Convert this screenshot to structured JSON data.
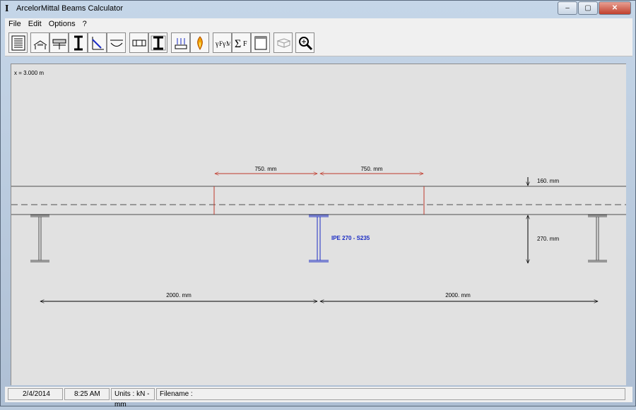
{
  "window": {
    "title": "ArcelorMittal Beams Calculator",
    "app_icon": "I",
    "buttons": {
      "minimize": "–",
      "maximize": "▢",
      "close": "✕"
    }
  },
  "menu": {
    "items": [
      "File",
      "Edit",
      "Options",
      "?"
    ]
  },
  "toolbar": {
    "buttons": [
      "list-icon",
      "load-icon",
      "deck-icon",
      "beam-icon",
      "stress-icon",
      "deflection-icon",
      "span-icon",
      "section-icon",
      "stacked-load-icon",
      "fire-icon",
      "coefficients-icon",
      "sum-forces-icon",
      "report-icon",
      "3d-view-icon",
      "zoom-icon"
    ]
  },
  "canvas": {
    "x_readout": "x = 3.000 m",
    "dim_left_top": "750. mm",
    "dim_right_top": "750. mm",
    "slab_thickness": "160. mm",
    "beam_height": "270. mm",
    "beam_label": "IPE 270 - S235",
    "span_left": "2000. mm",
    "span_right": "2000. mm",
    "colors": {
      "line": "#505050",
      "red": "#c0392b",
      "blue": "#1a2bc4",
      "dim": "#000000"
    }
  },
  "status": {
    "date": "2/4/2014",
    "time": "8:25 AM",
    "units": "Units : kN - mm",
    "filename": "Filename :"
  }
}
